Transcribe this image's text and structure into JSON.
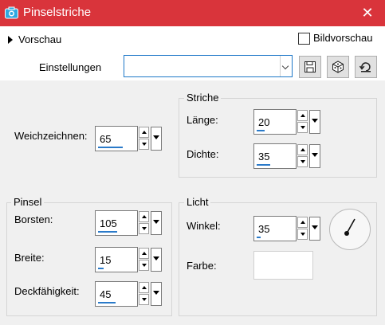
{
  "window": {
    "title": "Pinselstriche",
    "close_glyph": "✕"
  },
  "header": {
    "preview_label": "Vorschau",
    "bildvorschau_label": "Bildvorschau",
    "bildvorschau_checked": false
  },
  "presets": {
    "label": "Einstellungen",
    "value": ""
  },
  "settings": {
    "weichzeichnen": {
      "label": "Weichzeichnen:",
      "value": "65",
      "level": 0.65
    },
    "striche": {
      "title": "Striche",
      "laenge": {
        "label": "Länge:",
        "value": "20",
        "level": 0.2
      },
      "dichte": {
        "label": "Dichte:",
        "value": "35",
        "level": 0.35
      }
    },
    "pinsel": {
      "title": "Pinsel",
      "borsten": {
        "label": "Borsten:",
        "value": "105",
        "level": 0.5
      },
      "breite": {
        "label": "Breite:",
        "value": "15",
        "level": 0.15
      },
      "deckfaehigkeit": {
        "label": "Deckfähigkeit:",
        "value": "45",
        "level": 0.45
      }
    },
    "licht": {
      "title": "Licht",
      "winkel": {
        "label": "Winkel:",
        "value": "35",
        "level": 0.1
      },
      "farbe": {
        "label": "Farbe:",
        "color": "#ffffff"
      }
    }
  },
  "colors": {
    "titlebar": "#d9343b",
    "accent": "#2a7ac9"
  },
  "icons": [
    "camera-icon",
    "close-icon",
    "save-icon",
    "random-icon",
    "reset-icon",
    "angle-dial-icon"
  ]
}
